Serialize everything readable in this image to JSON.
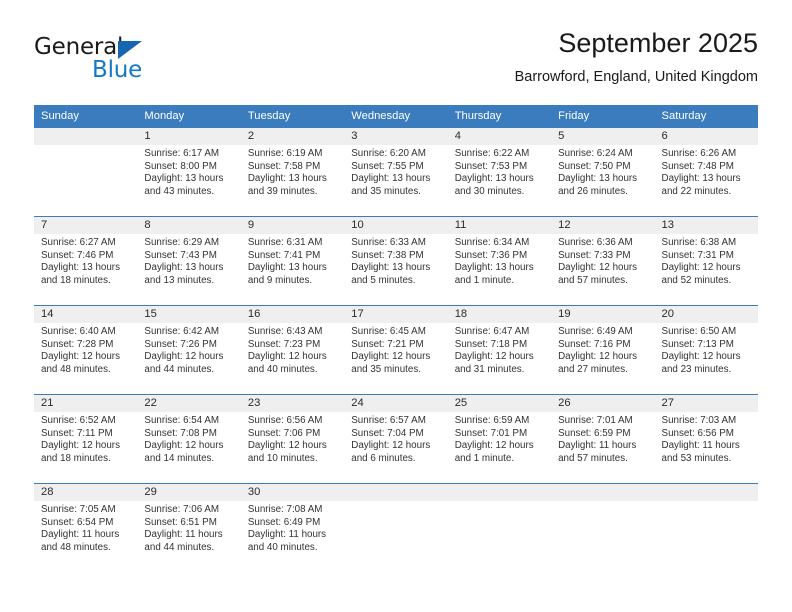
{
  "brand": {
    "name_part1": "General",
    "name_part2": "Blue",
    "logo_icon": "triangle-logo-icon",
    "accent_color": "#1479c4"
  },
  "header": {
    "title": "September 2025",
    "subtitle": "Barrowford, England, United Kingdom"
  },
  "calendar": {
    "header_bg": "#3a7cbe",
    "daynum_bg": "#efefef",
    "weekday_headers": [
      "Sunday",
      "Monday",
      "Tuesday",
      "Wednesday",
      "Thursday",
      "Friday",
      "Saturday"
    ],
    "weeks": [
      [
        {
          "day": "",
          "sunrise": "",
          "sunset": "",
          "daylight_line1": "",
          "daylight_line2": ""
        },
        {
          "day": "1",
          "sunrise": "Sunrise: 6:17 AM",
          "sunset": "Sunset: 8:00 PM",
          "daylight_line1": "Daylight: 13 hours",
          "daylight_line2": "and 43 minutes."
        },
        {
          "day": "2",
          "sunrise": "Sunrise: 6:19 AM",
          "sunset": "Sunset: 7:58 PM",
          "daylight_line1": "Daylight: 13 hours",
          "daylight_line2": "and 39 minutes."
        },
        {
          "day": "3",
          "sunrise": "Sunrise: 6:20 AM",
          "sunset": "Sunset: 7:55 PM",
          "daylight_line1": "Daylight: 13 hours",
          "daylight_line2": "and 35 minutes."
        },
        {
          "day": "4",
          "sunrise": "Sunrise: 6:22 AM",
          "sunset": "Sunset: 7:53 PM",
          "daylight_line1": "Daylight: 13 hours",
          "daylight_line2": "and 30 minutes."
        },
        {
          "day": "5",
          "sunrise": "Sunrise: 6:24 AM",
          "sunset": "Sunset: 7:50 PM",
          "daylight_line1": "Daylight: 13 hours",
          "daylight_line2": "and 26 minutes."
        },
        {
          "day": "6",
          "sunrise": "Sunrise: 6:26 AM",
          "sunset": "Sunset: 7:48 PM",
          "daylight_line1": "Daylight: 13 hours",
          "daylight_line2": "and 22 minutes."
        }
      ],
      [
        {
          "day": "7",
          "sunrise": "Sunrise: 6:27 AM",
          "sunset": "Sunset: 7:46 PM",
          "daylight_line1": "Daylight: 13 hours",
          "daylight_line2": "and 18 minutes."
        },
        {
          "day": "8",
          "sunrise": "Sunrise: 6:29 AM",
          "sunset": "Sunset: 7:43 PM",
          "daylight_line1": "Daylight: 13 hours",
          "daylight_line2": "and 13 minutes."
        },
        {
          "day": "9",
          "sunrise": "Sunrise: 6:31 AM",
          "sunset": "Sunset: 7:41 PM",
          "daylight_line1": "Daylight: 13 hours",
          "daylight_line2": "and 9 minutes."
        },
        {
          "day": "10",
          "sunrise": "Sunrise: 6:33 AM",
          "sunset": "Sunset: 7:38 PM",
          "daylight_line1": "Daylight: 13 hours",
          "daylight_line2": "and 5 minutes."
        },
        {
          "day": "11",
          "sunrise": "Sunrise: 6:34 AM",
          "sunset": "Sunset: 7:36 PM",
          "daylight_line1": "Daylight: 13 hours",
          "daylight_line2": "and 1 minute."
        },
        {
          "day": "12",
          "sunrise": "Sunrise: 6:36 AM",
          "sunset": "Sunset: 7:33 PM",
          "daylight_line1": "Daylight: 12 hours",
          "daylight_line2": "and 57 minutes."
        },
        {
          "day": "13",
          "sunrise": "Sunrise: 6:38 AM",
          "sunset": "Sunset: 7:31 PM",
          "daylight_line1": "Daylight: 12 hours",
          "daylight_line2": "and 52 minutes."
        }
      ],
      [
        {
          "day": "14",
          "sunrise": "Sunrise: 6:40 AM",
          "sunset": "Sunset: 7:28 PM",
          "daylight_line1": "Daylight: 12 hours",
          "daylight_line2": "and 48 minutes."
        },
        {
          "day": "15",
          "sunrise": "Sunrise: 6:42 AM",
          "sunset": "Sunset: 7:26 PM",
          "daylight_line1": "Daylight: 12 hours",
          "daylight_line2": "and 44 minutes."
        },
        {
          "day": "16",
          "sunrise": "Sunrise: 6:43 AM",
          "sunset": "Sunset: 7:23 PM",
          "daylight_line1": "Daylight: 12 hours",
          "daylight_line2": "and 40 minutes."
        },
        {
          "day": "17",
          "sunrise": "Sunrise: 6:45 AM",
          "sunset": "Sunset: 7:21 PM",
          "daylight_line1": "Daylight: 12 hours",
          "daylight_line2": "and 35 minutes."
        },
        {
          "day": "18",
          "sunrise": "Sunrise: 6:47 AM",
          "sunset": "Sunset: 7:18 PM",
          "daylight_line1": "Daylight: 12 hours",
          "daylight_line2": "and 31 minutes."
        },
        {
          "day": "19",
          "sunrise": "Sunrise: 6:49 AM",
          "sunset": "Sunset: 7:16 PM",
          "daylight_line1": "Daylight: 12 hours",
          "daylight_line2": "and 27 minutes."
        },
        {
          "day": "20",
          "sunrise": "Sunrise: 6:50 AM",
          "sunset": "Sunset: 7:13 PM",
          "daylight_line1": "Daylight: 12 hours",
          "daylight_line2": "and 23 minutes."
        }
      ],
      [
        {
          "day": "21",
          "sunrise": "Sunrise: 6:52 AM",
          "sunset": "Sunset: 7:11 PM",
          "daylight_line1": "Daylight: 12 hours",
          "daylight_line2": "and 18 minutes."
        },
        {
          "day": "22",
          "sunrise": "Sunrise: 6:54 AM",
          "sunset": "Sunset: 7:08 PM",
          "daylight_line1": "Daylight: 12 hours",
          "daylight_line2": "and 14 minutes."
        },
        {
          "day": "23",
          "sunrise": "Sunrise: 6:56 AM",
          "sunset": "Sunset: 7:06 PM",
          "daylight_line1": "Daylight: 12 hours",
          "daylight_line2": "and 10 minutes."
        },
        {
          "day": "24",
          "sunrise": "Sunrise: 6:57 AM",
          "sunset": "Sunset: 7:04 PM",
          "daylight_line1": "Daylight: 12 hours",
          "daylight_line2": "and 6 minutes."
        },
        {
          "day": "25",
          "sunrise": "Sunrise: 6:59 AM",
          "sunset": "Sunset: 7:01 PM",
          "daylight_line1": "Daylight: 12 hours",
          "daylight_line2": "and 1 minute."
        },
        {
          "day": "26",
          "sunrise": "Sunrise: 7:01 AM",
          "sunset": "Sunset: 6:59 PM",
          "daylight_line1": "Daylight: 11 hours",
          "daylight_line2": "and 57 minutes."
        },
        {
          "day": "27",
          "sunrise": "Sunrise: 7:03 AM",
          "sunset": "Sunset: 6:56 PM",
          "daylight_line1": "Daylight: 11 hours",
          "daylight_line2": "and 53 minutes."
        }
      ],
      [
        {
          "day": "28",
          "sunrise": "Sunrise: 7:05 AM",
          "sunset": "Sunset: 6:54 PM",
          "daylight_line1": "Daylight: 11 hours",
          "daylight_line2": "and 48 minutes."
        },
        {
          "day": "29",
          "sunrise": "Sunrise: 7:06 AM",
          "sunset": "Sunset: 6:51 PM",
          "daylight_line1": "Daylight: 11 hours",
          "daylight_line2": "and 44 minutes."
        },
        {
          "day": "30",
          "sunrise": "Sunrise: 7:08 AM",
          "sunset": "Sunset: 6:49 PM",
          "daylight_line1": "Daylight: 11 hours",
          "daylight_line2": "and 40 minutes."
        },
        {
          "day": "",
          "sunrise": "",
          "sunset": "",
          "daylight_line1": "",
          "daylight_line2": ""
        },
        {
          "day": "",
          "sunrise": "",
          "sunset": "",
          "daylight_line1": "",
          "daylight_line2": ""
        },
        {
          "day": "",
          "sunrise": "",
          "sunset": "",
          "daylight_line1": "",
          "daylight_line2": ""
        },
        {
          "day": "",
          "sunrise": "",
          "sunset": "",
          "daylight_line1": "",
          "daylight_line2": ""
        }
      ]
    ]
  }
}
